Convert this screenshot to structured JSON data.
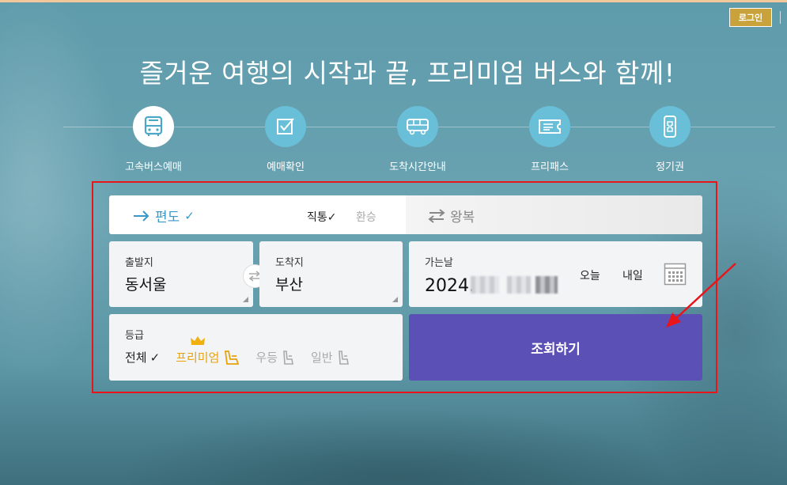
{
  "header": {
    "login_label": "로그인",
    "headline": "즐거운 여행의 시작과 끝, 프리미엄 버스와 함께!"
  },
  "menu": {
    "items": [
      {
        "label": "고속버스예매",
        "icon": "bus-icon",
        "active": true
      },
      {
        "label": "예매확인",
        "icon": "checkbox-icon",
        "active": false
      },
      {
        "label": "도착시간안내",
        "icon": "bus-side-icon",
        "active": false
      },
      {
        "label": "프리패스",
        "icon": "ticket-icon",
        "active": false
      },
      {
        "label": "정기권",
        "icon": "phone-pass-icon",
        "active": false
      }
    ]
  },
  "trip": {
    "oneway_label": "편도",
    "direct_label": "직통",
    "transfer_label": "환승",
    "round_label": "왕복"
  },
  "route": {
    "departure_label": "출발지",
    "departure_value": "동서울",
    "arrival_label": "도착지",
    "arrival_value": "부산"
  },
  "date": {
    "label": "가는날",
    "value": "2024.",
    "today_label": "오늘",
    "tomorrow_label": "내일"
  },
  "grade": {
    "label": "등급",
    "options": [
      {
        "label": "전체",
        "selected": true,
        "color": "#222222"
      },
      {
        "label": "프리미엄",
        "selected": false,
        "color": "#e8a20c"
      },
      {
        "label": "우등",
        "selected": false,
        "color": "#aaaaaa"
      },
      {
        "label": "일반",
        "selected": false,
        "color": "#aaaaaa"
      }
    ]
  },
  "search": {
    "label": "조회하기"
  },
  "colors": {
    "accent_purple": "#5a50b5",
    "accent_blue": "#3a98c8",
    "login_gold": "#c9a23b",
    "highlight_red": "#e8161b"
  }
}
